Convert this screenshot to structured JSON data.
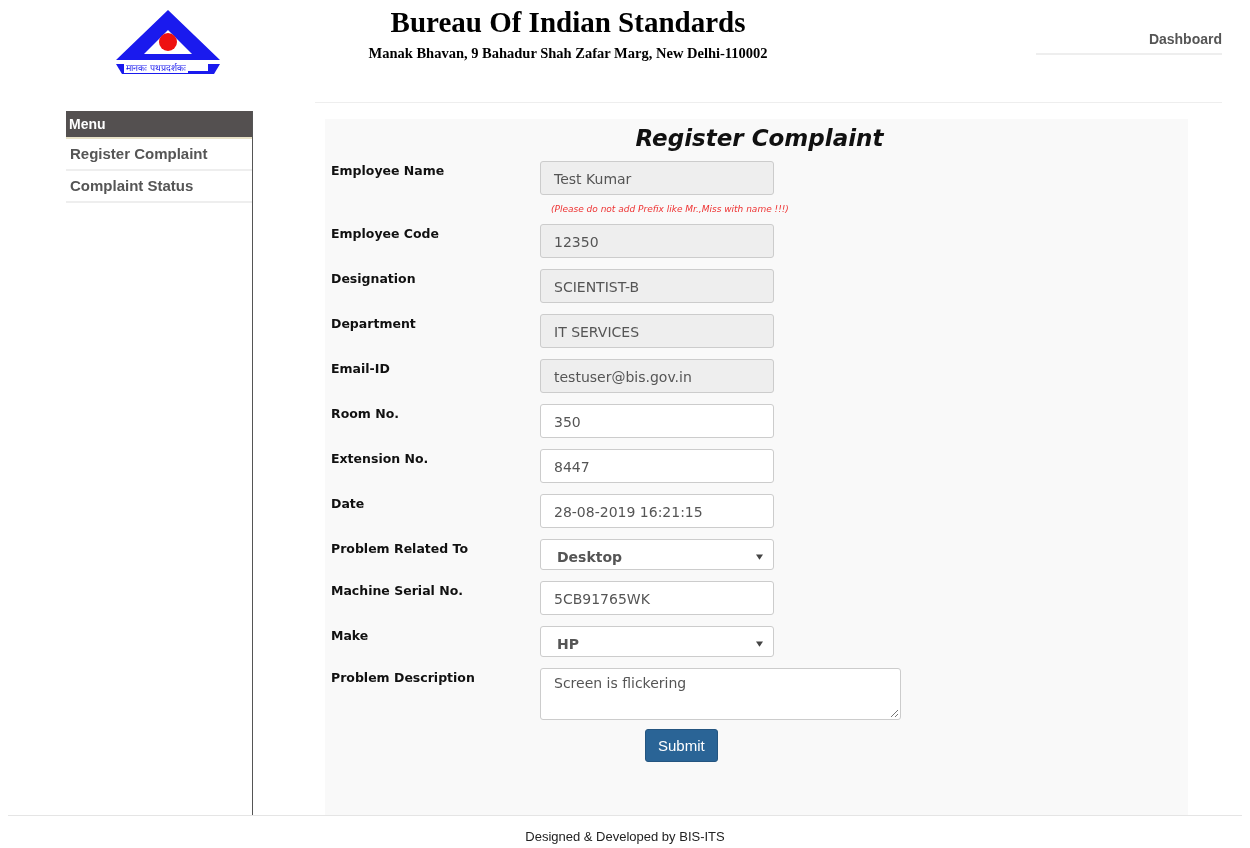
{
  "header": {
    "logo_motto": "मानकः पथप्रदर्शकः",
    "title": "Bureau Of Indian Standards",
    "address": "Manak Bhavan, 9 Bahadur Shah Zafar Marg, New Delhi-110002",
    "nav_link": "Dashboard"
  },
  "sidebar": {
    "heading": "Menu",
    "items": [
      {
        "label": "Register Complaint",
        "selected": false
      },
      {
        "label": "Complaint Status",
        "selected": false
      }
    ]
  },
  "form": {
    "title": "Register Complaint",
    "fields": [
      {
        "kind": "input",
        "label": "Employee Name",
        "value": "Test Kumar",
        "disabled": true,
        "hint": "(Please do not add Prefix like Mr.,Miss with name !!!)"
      },
      {
        "kind": "input",
        "label": "Employee Code",
        "value": "12350",
        "disabled": true
      },
      {
        "kind": "input",
        "label": "Designation",
        "value": "SCIENTIST-B",
        "disabled": true
      },
      {
        "kind": "input",
        "label": "Department",
        "value": "IT SERVICES",
        "disabled": true
      },
      {
        "kind": "input",
        "label": "Email-ID",
        "value": "testuser@bis.gov.in",
        "disabled": true
      },
      {
        "kind": "input",
        "label": "Room No.",
        "value": "350",
        "disabled": false
      },
      {
        "kind": "input",
        "label": "Extension No.",
        "value": "8447",
        "disabled": false
      },
      {
        "kind": "input",
        "label": "Date",
        "value": "28-08-2019 16:21:15",
        "disabled": false
      },
      {
        "kind": "select",
        "label": "Problem Related To",
        "value": "Desktop"
      },
      {
        "kind": "input",
        "label": "Machine Serial No.",
        "value": "5CB91765WK",
        "disabled": false
      },
      {
        "kind": "select",
        "label": "Make",
        "value": "HP"
      },
      {
        "kind": "textarea",
        "label": "Problem Description",
        "value": "Screen is flickering"
      }
    ],
    "submit": "Submit"
  },
  "footer": "Designed & Developed by BIS-ITS"
}
